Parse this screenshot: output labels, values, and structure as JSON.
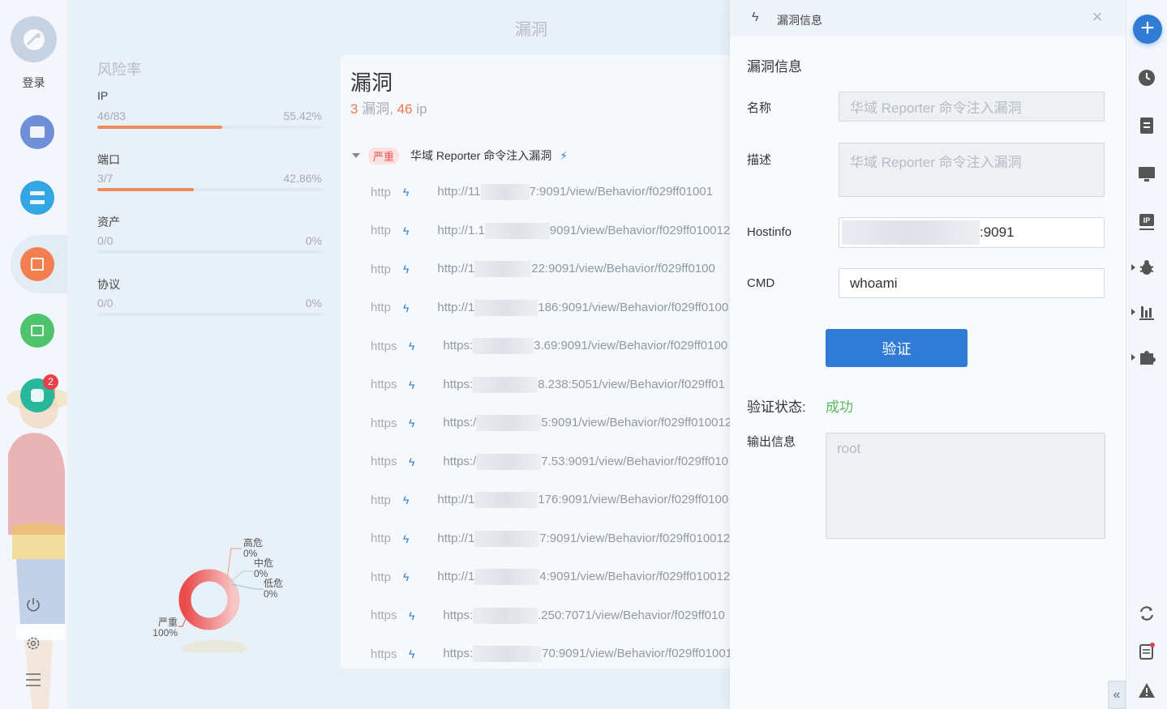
{
  "nav": {
    "login_label": "登录",
    "badge_count": "2",
    "colors": {
      "blue": "#6f8fd8",
      "cyan": "#35a6e4",
      "orange": "#f17f4f",
      "green": "#4ec36c",
      "teal": "#27b79a"
    },
    "icons": [
      "satellite-icon",
      "window-icon",
      "server-icon",
      "report-icon",
      "chart-icon",
      "puzzle-icon",
      "power-icon",
      "settings-icon",
      "menu-icon"
    ]
  },
  "page": {
    "title": "漏洞"
  },
  "risk": {
    "title": "风险率",
    "items": [
      {
        "label": "IP",
        "value": "46/83",
        "percent": "55.42%",
        "fill": 0.5542
      },
      {
        "label": "端口",
        "value": "3/7",
        "percent": "42.86%",
        "fill": 0.4286
      },
      {
        "label": "资产",
        "value": "0/0",
        "percent": "0%",
        "fill": 0
      },
      {
        "label": "协议",
        "value": "0/0",
        "percent": "0%",
        "fill": 0
      }
    ]
  },
  "donut": {
    "high_label": "高危",
    "high_pct": "0%",
    "mid_label": "中危",
    "mid_pct": "0%",
    "low_label": "低危",
    "low_pct": "0%",
    "crit_label": "严重",
    "crit_pct": "100%"
  },
  "vulns": {
    "title": "漏洞",
    "count": "3",
    "count_unit": "漏洞,",
    "ip_count": "46",
    "ip_unit": "ip",
    "group": {
      "severity": "严重",
      "name": "华域 Reporter 命令注入漏洞"
    },
    "rows": [
      {
        "proto": "http",
        "prefix": "http://11",
        "suffix": "7:9091/view/Behavior/f029ff01001"
      },
      {
        "proto": "http",
        "prefix": "http://1.1",
        "suffix": "9091/view/Behavior/f029ff010012"
      },
      {
        "proto": "http",
        "prefix": "http://1",
        "suffix": "22:9091/view/Behavior/f029ff0100"
      },
      {
        "proto": "http",
        "prefix": "http://1",
        "suffix": "186:9091/view/Behavior/f029ff0100"
      },
      {
        "proto": "https",
        "prefix": "https:",
        "suffix": "3.69:9091/view/Behavior/f029ff0100"
      },
      {
        "proto": "https",
        "prefix": "https:",
        "suffix": "8.238:5051/view/Behavior/f029ff01"
      },
      {
        "proto": "https",
        "prefix": "https:/",
        "suffix": "5:9091/view/Behavior/f029ff010012"
      },
      {
        "proto": "https",
        "prefix": "https:/",
        "suffix": "7.53:9091/view/Behavior/f029ff010"
      },
      {
        "proto": "http",
        "prefix": "http://1",
        "suffix": "176:9091/view/Behavior/f029ff0100"
      },
      {
        "proto": "http",
        "prefix": "http://1",
        "suffix": "7:9091/view/Behavior/f029ff010012"
      },
      {
        "proto": "http",
        "prefix": "http://1",
        "suffix": "4:9091/view/Behavior/f029ff010012"
      },
      {
        "proto": "https",
        "prefix": "https:",
        "suffix": ".250:7071/view/Behavior/f029ff010"
      },
      {
        "proto": "https",
        "prefix": "https:",
        "suffix": "70:9091/view/Behavior/f029ff01001"
      }
    ]
  },
  "drawer": {
    "header_title": "漏洞信息",
    "section_title": "漏洞信息",
    "name_label": "名称",
    "name_value": "华域 Reporter 命令注入漏洞",
    "desc_label": "描述",
    "desc_value": "华域 Reporter 命令注入漏洞",
    "hostinfo_label": "Hostinfo",
    "hostinfo_value": ":9091",
    "cmd_label": "CMD",
    "cmd_value": "whoami",
    "verify_button": "验证",
    "status_label": "验证状态:",
    "status_value": "成功",
    "output_label": "输出信息",
    "output_value": "root"
  },
  "rightrail": {
    "add_label": "+",
    "icons": [
      "clock-icon",
      "document-icon",
      "monitor-icon",
      "ip-icon",
      "bug-icon",
      "bar-chart-icon",
      "puzzle-icon",
      "refresh-icon",
      "report-icon",
      "warning-icon"
    ],
    "collapse_label": "«"
  }
}
